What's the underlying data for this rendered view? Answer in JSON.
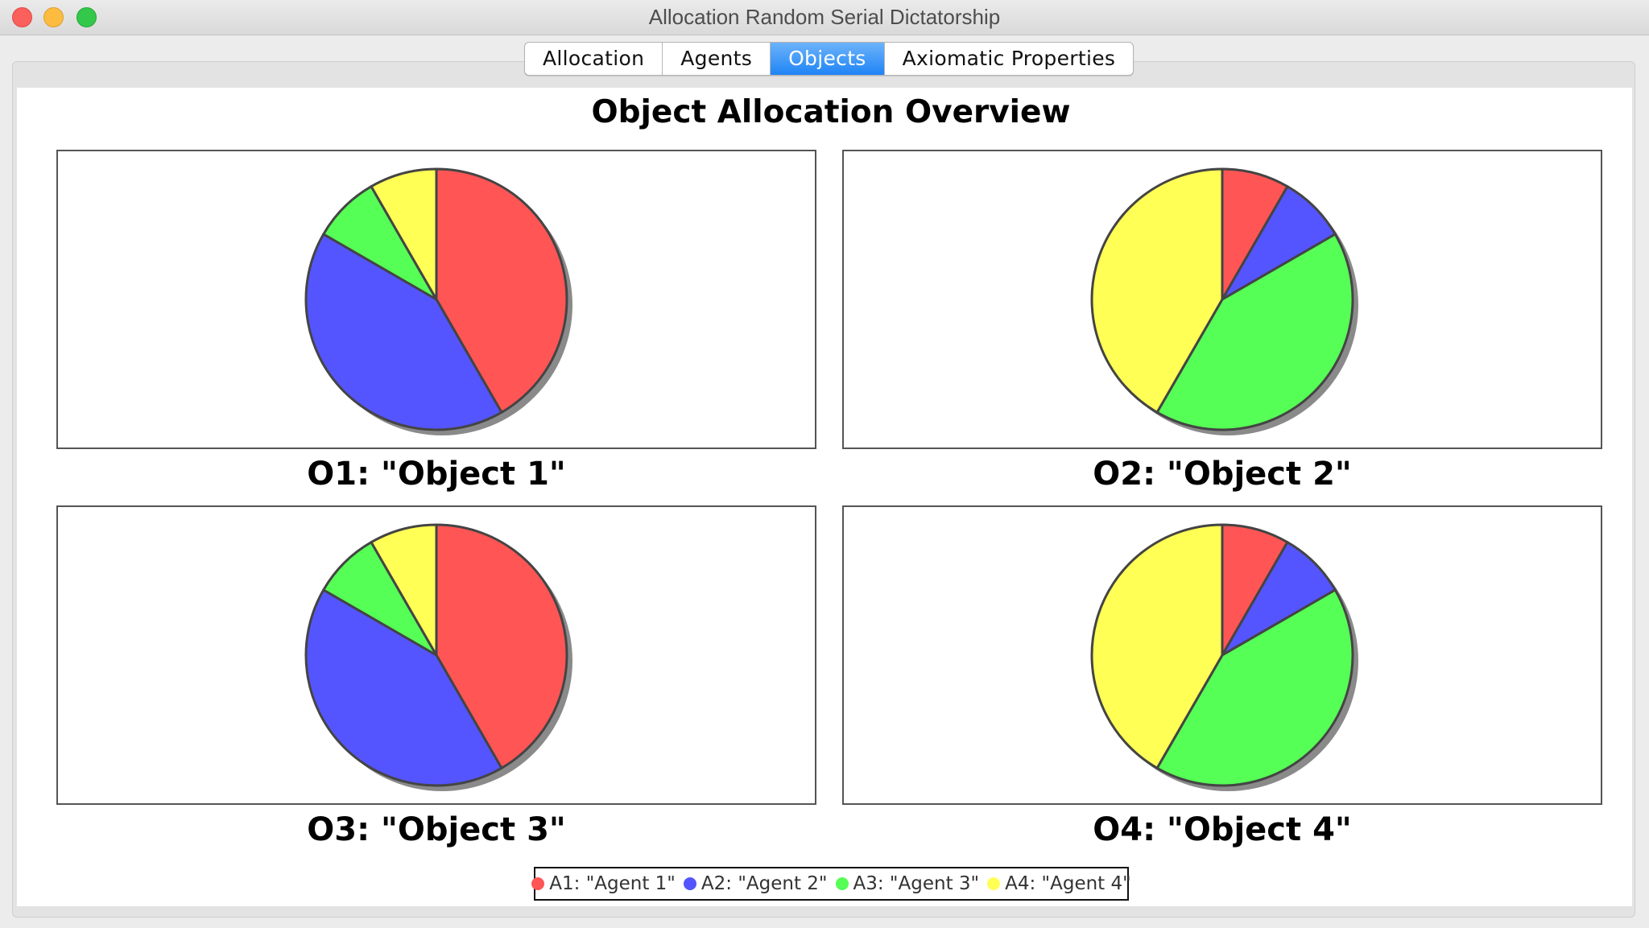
{
  "window": {
    "title": "Allocation Random Serial Dictatorship"
  },
  "tabs": [
    {
      "label": "Allocation",
      "active": false
    },
    {
      "label": "Agents",
      "active": false
    },
    {
      "label": "Objects",
      "active": true
    },
    {
      "label": "Axiomatic Properties",
      "active": false
    }
  ],
  "overview": {
    "title": "Object Allocation Overview"
  },
  "legend": [
    {
      "label": "A1: \"Agent 1\"",
      "color": "#ff5555"
    },
    {
      "label": "A2: \"Agent 2\"",
      "color": "#5555ff"
    },
    {
      "label": "A3: \"Agent 3\"",
      "color": "#55ff55"
    },
    {
      "label": "A4: \"Agent 4\"",
      "color": "#ffff55"
    }
  ],
  "chart_data": [
    {
      "type": "pie",
      "title": "O1: \"Object 1\"",
      "categories": [
        "A1: \"Agent 1\"",
        "A2: \"Agent 2\"",
        "A3: \"Agent 3\"",
        "A4: \"Agent 4\""
      ],
      "values": [
        0.4167,
        0.4167,
        0.0833,
        0.0833
      ],
      "colors": [
        "#ff5555",
        "#5555ff",
        "#55ff55",
        "#ffff55"
      ]
    },
    {
      "type": "pie",
      "title": "O2: \"Object 2\"",
      "categories": [
        "A1: \"Agent 1\"",
        "A2: \"Agent 2\"",
        "A3: \"Agent 3\"",
        "A4: \"Agent 4\""
      ],
      "values": [
        0.0833,
        0.0833,
        0.4167,
        0.4167
      ],
      "colors": [
        "#ff5555",
        "#5555ff",
        "#55ff55",
        "#ffff55"
      ]
    },
    {
      "type": "pie",
      "title": "O3: \"Object 3\"",
      "categories": [
        "A1: \"Agent 1\"",
        "A2: \"Agent 2\"",
        "A3: \"Agent 3\"",
        "A4: \"Agent 4\""
      ],
      "values": [
        0.4167,
        0.4167,
        0.0833,
        0.0833
      ],
      "colors": [
        "#ff5555",
        "#5555ff",
        "#55ff55",
        "#ffff55"
      ]
    },
    {
      "type": "pie",
      "title": "O4: \"Object 4\"",
      "categories": [
        "A1: \"Agent 1\"",
        "A2: \"Agent 2\"",
        "A3: \"Agent 3\"",
        "A4: \"Agent 4\""
      ],
      "values": [
        0.0833,
        0.0833,
        0.4167,
        0.4167
      ],
      "colors": [
        "#ff5555",
        "#5555ff",
        "#55ff55",
        "#ffff55"
      ]
    }
  ]
}
